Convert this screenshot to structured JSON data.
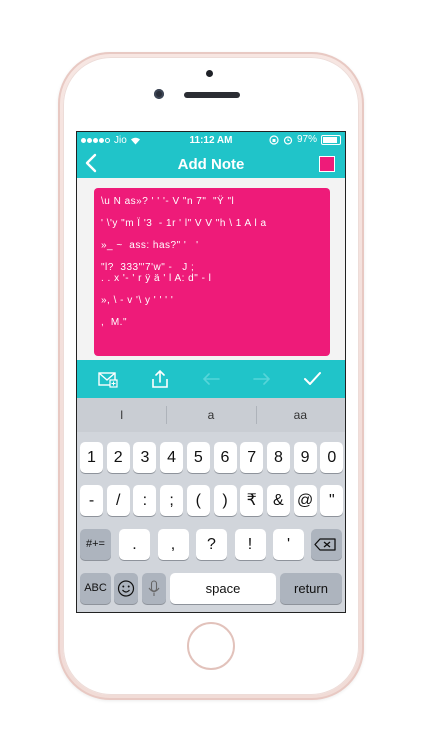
{
  "status": {
    "carrier": "Jio",
    "time": "11:12 AM",
    "battery": "97%",
    "battery_level": 0.97
  },
  "nav": {
    "back_icon": "chevron-left-icon",
    "title": "Add Note",
    "swatch_color": "#ee1b79"
  },
  "note": {
    "color": "#ee1b79",
    "lines": [
      "\\u N as»? ' ' '- V \"n 7\"  \"Ÿ \"l",
      "",
      "' \\'y \"m Ï '3  - 1r ' l\" V V \"h \\ 1 A l a",
      "",
      "»_ ~  ass: has?\" '   '",
      "",
      "\"l?  333\"'7'w\" -   J ;",
      ". . x '- ' r ÿ ä ' l A: d\" - l",
      "",
      "», \\ - v '\\ y ' ' ' '",
      "",
      ",  M.\""
    ]
  },
  "toolbar": {
    "icons": [
      "email-icon",
      "share-icon",
      "undo-icon",
      "redo-icon",
      "check-icon"
    ]
  },
  "keyboard": {
    "suggestions": [
      "l",
      "a",
      "aa"
    ],
    "row1": [
      "1",
      "2",
      "3",
      "4",
      "5",
      "6",
      "7",
      "8",
      "9",
      "0"
    ],
    "row2": [
      "-",
      "/",
      ":",
      ";",
      "(",
      ")",
      "₹",
      "&",
      "@",
      "\""
    ],
    "row3": [
      ".",
      ",",
      "?",
      "!",
      "'"
    ],
    "shift_label": "#+=",
    "abc_label": "ABC",
    "space_label": "space",
    "return_label": "return"
  }
}
